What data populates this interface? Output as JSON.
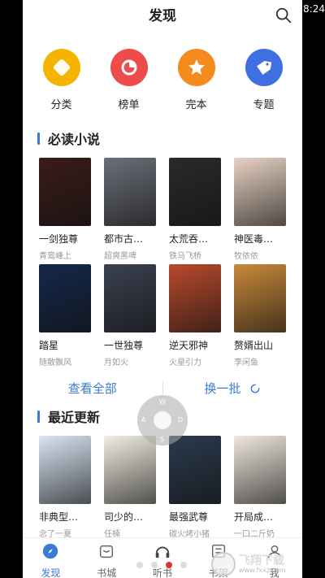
{
  "status": {
    "time": "8:24"
  },
  "header": {
    "title": "发现"
  },
  "categories": [
    {
      "label": "分类",
      "color": "#f5b400",
      "icon": "square-grid-icon"
    },
    {
      "label": "榜单",
      "color": "#ee4b4b",
      "icon": "ranking-icon"
    },
    {
      "label": "完本",
      "color": "#f58a1f",
      "icon": "star-icon"
    },
    {
      "label": "专题",
      "color": "#3f6fe0",
      "icon": "tag-icon"
    }
  ],
  "must_read": {
    "title": "必读小说",
    "books": [
      {
        "name": "一剑独尊",
        "author": "青鸾峰上",
        "cover": "#3a1c18"
      },
      {
        "name": "都市古…",
        "author": "超爽黑啤",
        "cover": "#6b6f78"
      },
      {
        "name": "太荒吞…",
        "author": "铁马飞桥",
        "cover": "#2a2a2a"
      },
      {
        "name": "神医毒…",
        "author": "牧依依",
        "cover": "#e8d3c4"
      },
      {
        "name": "踏星",
        "author": "随散飘风",
        "cover": "#14274a"
      },
      {
        "name": "一世独尊",
        "author": "月如火",
        "cover": "#3a4150"
      },
      {
        "name": "逆天邪神",
        "author": "火星引力",
        "cover": "#b84a2c"
      },
      {
        "name": "赘婿出山",
        "author": "李闲鱼",
        "cover": "#c9893a"
      }
    ],
    "view_all": "查看全部",
    "refresh": "换一批"
  },
  "recent": {
    "title": "最近更新",
    "books": [
      {
        "name": "非典型…",
        "author": "念了一夏",
        "cover": "#d9e5f3"
      },
      {
        "name": "司少的…",
        "author": "任楠",
        "cover": "#f2eee2"
      },
      {
        "name": "最强武尊",
        "author": "碳火烤小猪",
        "cover": "#2b3a4d"
      },
      {
        "name": "开局成…",
        "author": "一口二斤奶",
        "cover": "#efe8de"
      }
    ]
  },
  "joystick": {
    "keys": [
      "W",
      "A",
      "S",
      "D"
    ]
  },
  "tabs": [
    {
      "label": "发现",
      "active": true
    },
    {
      "label": "书城",
      "active": false
    },
    {
      "label": "听书",
      "active": false
    },
    {
      "label": "书架",
      "active": false
    },
    {
      "label": "我",
      "active": false
    }
  ],
  "watermark": {
    "name": "飞翔下载",
    "url": "www.fxxz.com"
  }
}
